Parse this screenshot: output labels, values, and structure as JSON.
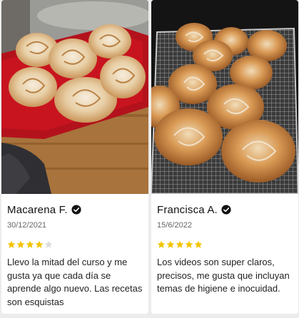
{
  "reviews": [
    {
      "author": "Macarena F.",
      "date": "30/12/2021",
      "rating": 4,
      "max_rating": 5,
      "text": "Llevo la mitad del curso y me gusta ya que cada día se aprende algo nuevo. Las recetas son esquistas",
      "photo_icon": "cinnamon-rolls-on-red-plate-photo"
    },
    {
      "author": "Francisca A.",
      "date": "15/6/2022",
      "rating": 5,
      "max_rating": 5,
      "text": "Los videos son super claros, precisos, me gusta que incluyan temas de higiene e inocuidad.",
      "photo_icon": "cinnamon-rolls-on-wire-rack-photo"
    }
  ],
  "colors": {
    "star_filled": "#f2c400",
    "star_empty": "#dcdcdc",
    "verified": "#111111"
  },
  "icons": {
    "verified": "verified-check-icon",
    "star": "star-icon"
  }
}
